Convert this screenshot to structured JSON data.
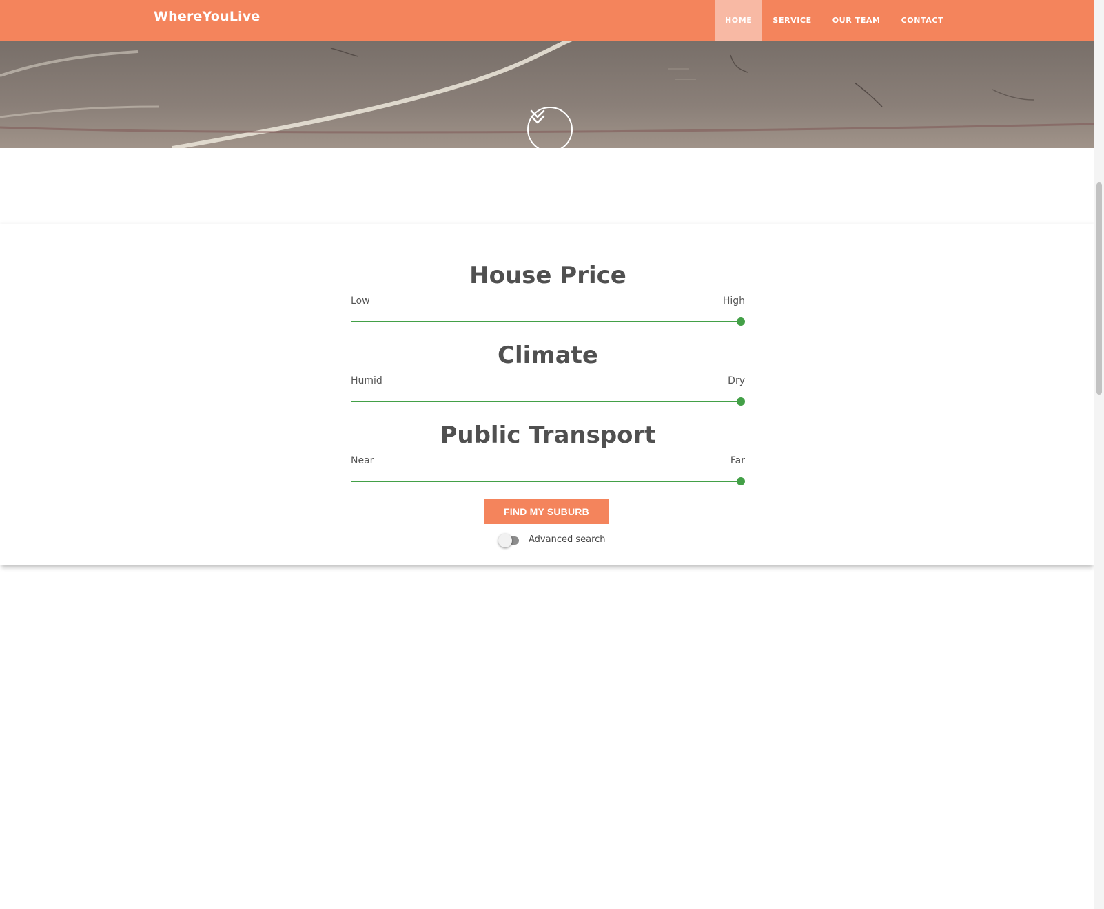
{
  "nav": {
    "brand": "WhereYouLive",
    "items": [
      {
        "label": "HOME",
        "active": true
      },
      {
        "label": "SERVICE",
        "active": false
      },
      {
        "label": "OUR TEAM",
        "active": false
      },
      {
        "label": "CONTACT",
        "active": false
      }
    ]
  },
  "hero": {
    "scroll_icon": "double-chevron-down-icon"
  },
  "search": {
    "criteria": [
      {
        "title": "House Price",
        "low_label": "Low",
        "high_label": "High",
        "value_fraction": 1.0
      },
      {
        "title": "Climate",
        "low_label": "Humid",
        "high_label": "Dry",
        "value_fraction": 1.0
      },
      {
        "title": "Public Transport",
        "low_label": "Near",
        "high_label": "Far",
        "value_fraction": 1.0
      }
    ],
    "submit_label": "FIND MY SUBURB",
    "advanced_toggle": {
      "label": "Advanced search",
      "on": false
    }
  },
  "colors": {
    "brand_orange": "#f4845c",
    "nav_active": "#f8b9a4",
    "slider_green": "#43a047",
    "heading_gray": "#505050"
  }
}
